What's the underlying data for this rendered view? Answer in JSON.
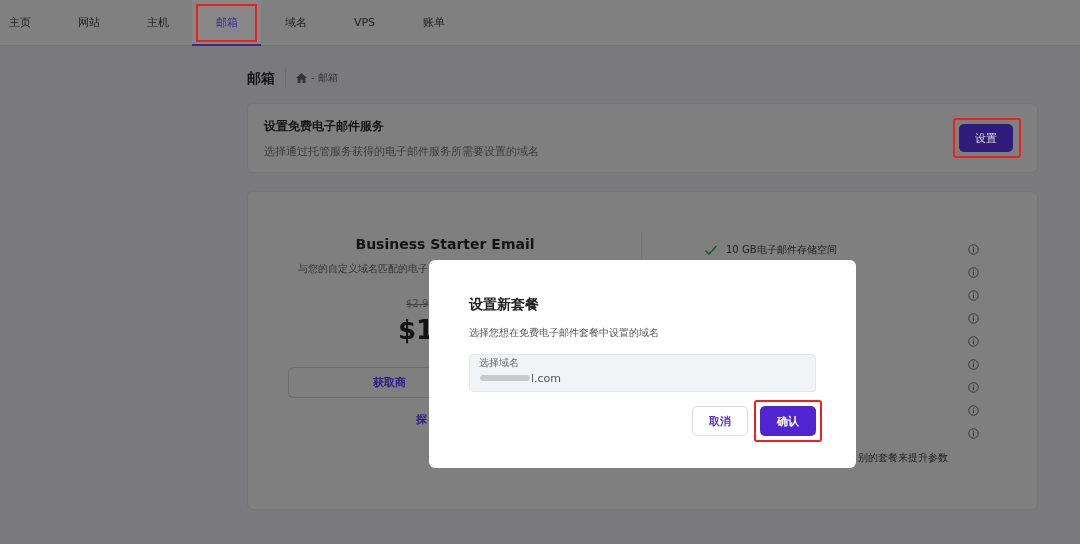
{
  "nav": {
    "tabs": [
      {
        "label": "主页",
        "selected": false,
        "highlighted": false
      },
      {
        "label": "网站",
        "selected": false,
        "highlighted": false
      },
      {
        "label": "主机",
        "selected": false,
        "highlighted": false
      },
      {
        "label": "邮箱",
        "selected": true,
        "highlighted": true
      },
      {
        "label": "域名",
        "selected": false,
        "highlighted": false
      },
      {
        "label": "VPS",
        "selected": false,
        "highlighted": false
      },
      {
        "label": "账单",
        "selected": false,
        "highlighted": false
      }
    ]
  },
  "breadcrumb": {
    "title": "邮箱",
    "trail": "- 邮箱"
  },
  "setup_card": {
    "title": "设置免费电子邮件服务",
    "description": "选择通过托管服务获得的电子邮件服务所需要设置的域名",
    "button": {
      "label": "设置",
      "highlighted": true
    }
  },
  "plan_card": {
    "name": "Business Starter Email",
    "description": "与您的自定义域名匹配的电子",
    "old_price": "$2.9",
    "price": "$1",
    "action_button": "获取商",
    "link": "探",
    "features": [
      {
        "kind": "text",
        "text": "10 GB电子邮件存储空间"
      },
      {
        "kind": "hidden"
      },
      {
        "kind": "hidden"
      },
      {
        "kind": "hidden"
      },
      {
        "kind": "hidden"
      },
      {
        "kind": "hidden"
      },
      {
        "kind": "hidden"
      },
      {
        "kind": "hidden"
      },
      {
        "kind": "hidden"
      }
    ],
    "footnote": "别的套餐来提升参数"
  },
  "modal": {
    "title": "设置新套餐",
    "description": "选择您想在免费电子邮件套餐中设置的域名",
    "field": {
      "label": "选择域名",
      "value": "l.com"
    },
    "buttons": [
      {
        "label": "取消",
        "kind": "secondary",
        "highlighted": false
      },
      {
        "label": "确认",
        "kind": "primary",
        "highlighted": true
      }
    ]
  }
}
